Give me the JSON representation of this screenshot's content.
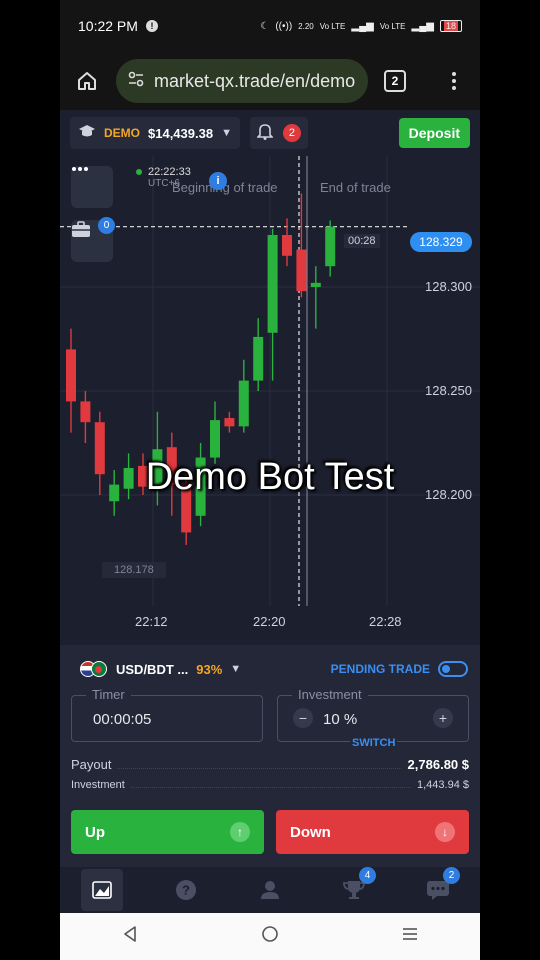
{
  "status_bar": {
    "time": "10:22 PM",
    "notification_icon": "info-dot",
    "net_speed": "2.20\nK/S",
    "sim1": "Vo LTE",
    "sim2": "Vo LTE",
    "network": "4G",
    "battery": "18"
  },
  "browser": {
    "url": "market-qx.trade/en/demo",
    "tab_count": "2"
  },
  "header": {
    "account_mode": "DEMO",
    "balance": "$14,439.38",
    "notification_count": "2",
    "deposit_label": "Deposit"
  },
  "chart": {
    "server_time": "22:22:33",
    "timezone": "UTC+6",
    "beginning_label": "Beginning of trade",
    "end_label": "End of trade",
    "trades_badge": "0",
    "current_price": "128.329",
    "countdown": "00:28",
    "y_labels": [
      "128.300",
      "128.250",
      "128.200"
    ],
    "x_labels": [
      "22:12",
      "22:20",
      "22:28"
    ],
    "low_marker": "128.178",
    "overlay_text": "Demo Bot Test"
  },
  "chart_data": {
    "type": "candlestick",
    "x_ticks": [
      "22:12",
      "22:20",
      "22:28"
    ],
    "y_ticks": [
      128.3,
      128.25,
      128.2
    ],
    "current_price": 128.329,
    "low_marker": 128.178,
    "candles": [
      {
        "open": 128.245,
        "close": 128.27,
        "high": 128.28,
        "low": 128.23,
        "dir": "down"
      },
      {
        "open": 128.245,
        "close": 128.235,
        "high": 128.25,
        "low": 128.225,
        "dir": "down"
      },
      {
        "open": 128.235,
        "close": 128.21,
        "high": 128.24,
        "low": 128.2,
        "dir": "down"
      },
      {
        "open": 128.205,
        "close": 128.197,
        "high": 128.212,
        "low": 128.19,
        "dir": "green"
      },
      {
        "open": 128.203,
        "close": 128.213,
        "high": 128.22,
        "low": 128.198,
        "dir": "green"
      },
      {
        "open": 128.214,
        "close": 128.204,
        "high": 128.22,
        "low": 128.2,
        "dir": "down"
      },
      {
        "open": 128.203,
        "close": 128.222,
        "high": 128.24,
        "low": 128.195,
        "dir": "green"
      },
      {
        "open": 128.223,
        "close": 128.205,
        "high": 128.23,
        "low": 128.19,
        "dir": "down"
      },
      {
        "open": 128.205,
        "close": 128.182,
        "high": 128.21,
        "low": 128.176,
        "dir": "down"
      },
      {
        "open": 128.19,
        "close": 128.218,
        "high": 128.225,
        "low": 128.185,
        "dir": "green"
      },
      {
        "open": 128.218,
        "close": 128.236,
        "high": 128.245,
        "low": 128.215,
        "dir": "green"
      },
      {
        "open": 128.237,
        "close": 128.233,
        "high": 128.24,
        "low": 128.23,
        "dir": "down"
      },
      {
        "open": 128.233,
        "close": 128.255,
        "high": 128.265,
        "low": 128.23,
        "dir": "green"
      },
      {
        "open": 128.255,
        "close": 128.276,
        "high": 128.285,
        "low": 128.25,
        "dir": "green"
      },
      {
        "open": 128.278,
        "close": 128.325,
        "high": 128.328,
        "low": 128.255,
        "dir": "green"
      },
      {
        "open": 128.325,
        "close": 128.315,
        "high": 128.333,
        "low": 128.31,
        "dir": "down"
      },
      {
        "open": 128.318,
        "close": 128.298,
        "high": 128.345,
        "low": 128.295,
        "dir": "down"
      },
      {
        "open": 128.302,
        "close": 128.3,
        "high": 128.31,
        "low": 128.28,
        "dir": "green"
      },
      {
        "open": 128.31,
        "close": 128.329,
        "high": 128.332,
        "low": 128.305,
        "dir": "green"
      }
    ]
  },
  "panel": {
    "asset": "USD/BDT ...",
    "payout_percent": "93%",
    "pending_label": "PENDING TRADE",
    "timer_label": "Timer",
    "timer_value": "00:00:05",
    "investment_label": "Investment",
    "investment_value": "10 %",
    "switch_label": "SWITCH",
    "payout_label": "Payout",
    "payout_value": "2,786.80 $",
    "investment_row_label": "Investment",
    "investment_row_value": "1,443.94 $",
    "up_label": "Up",
    "down_label": "Down"
  },
  "bottom_nav": {
    "trophy_badge": "4",
    "chat_badge": "2"
  },
  "colors": {
    "bg": "#1c1f2d",
    "green": "#2ab23e",
    "red": "#e0393e",
    "blue": "#2f8ff0",
    "orange": "#f5a623"
  }
}
